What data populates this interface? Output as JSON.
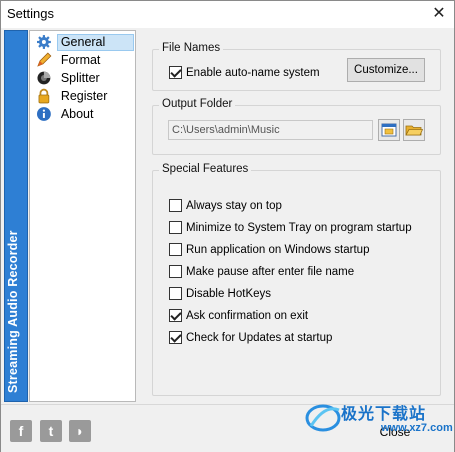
{
  "window": {
    "title": "Settings",
    "close_glyph": "✕"
  },
  "banner": {
    "text": "Streaming Audio Recorder",
    "color": "#2e7fd4"
  },
  "nav": {
    "items": [
      {
        "label": "General",
        "icon": "gear-icon",
        "selected": true
      },
      {
        "label": "Format",
        "icon": "pencil-icon",
        "selected": false
      },
      {
        "label": "Splitter",
        "icon": "splitter-icon",
        "selected": false
      },
      {
        "label": "Register",
        "icon": "lock-icon",
        "selected": false
      },
      {
        "label": "About",
        "icon": "info-icon",
        "selected": false
      }
    ]
  },
  "file_names": {
    "title": "File Names",
    "auto_name_label": "Enable auto-name system",
    "auto_name_checked": true,
    "customize_label": "Customize..."
  },
  "output_folder": {
    "title": "Output Folder",
    "path": "C:\\Users\\admin\\Music"
  },
  "special_features": {
    "title": "Special  Features",
    "options": [
      {
        "label": "Always stay on top",
        "checked": false
      },
      {
        "label": "Minimize to System Tray on program startup",
        "checked": false
      },
      {
        "label": "Run application on Windows startup",
        "checked": false
      },
      {
        "label": "Make pause after enter file name",
        "checked": false
      },
      {
        "label": "Disable HotKeys",
        "checked": false
      },
      {
        "label": "Ask confirmation on exit",
        "checked": true
      },
      {
        "label": "Check for Updates at startup",
        "checked": true
      }
    ]
  },
  "footer": {
    "facebook_glyph": "f",
    "twitter_glyph": "t",
    "rss_glyph": "◗",
    "close_label": "Close"
  },
  "watermark": {
    "text": "极光下载站",
    "url": "www.xz7.com"
  }
}
